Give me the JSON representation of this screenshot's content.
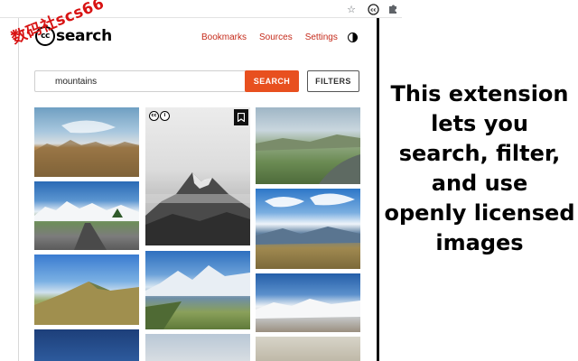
{
  "browser": {
    "icons": [
      "star-icon",
      "cc-search-extension-icon",
      "puzzle-extensions-icon"
    ]
  },
  "app": {
    "logo_cc": "cc",
    "logo_text": "search"
  },
  "nav": {
    "bookmarks": "Bookmarks",
    "sources": "Sources",
    "settings": "Settings"
  },
  "watermark": "数码社scs66",
  "search": {
    "value": "mountains",
    "button_label": "SEARCH",
    "filters_label": "FILTERS"
  },
  "results": {
    "hovered_license_icons": [
      "cc-icon",
      "by-icon"
    ],
    "bookmark_icon": "bookmark-icon"
  },
  "promo": {
    "lines": [
      "This extension",
      "lets you",
      "search, filter,",
      "and use",
      "openly licensed",
      "images"
    ]
  },
  "colors": {
    "accent": "#e8501f",
    "nav_link": "#c52b1b",
    "watermark": "#d81313"
  }
}
